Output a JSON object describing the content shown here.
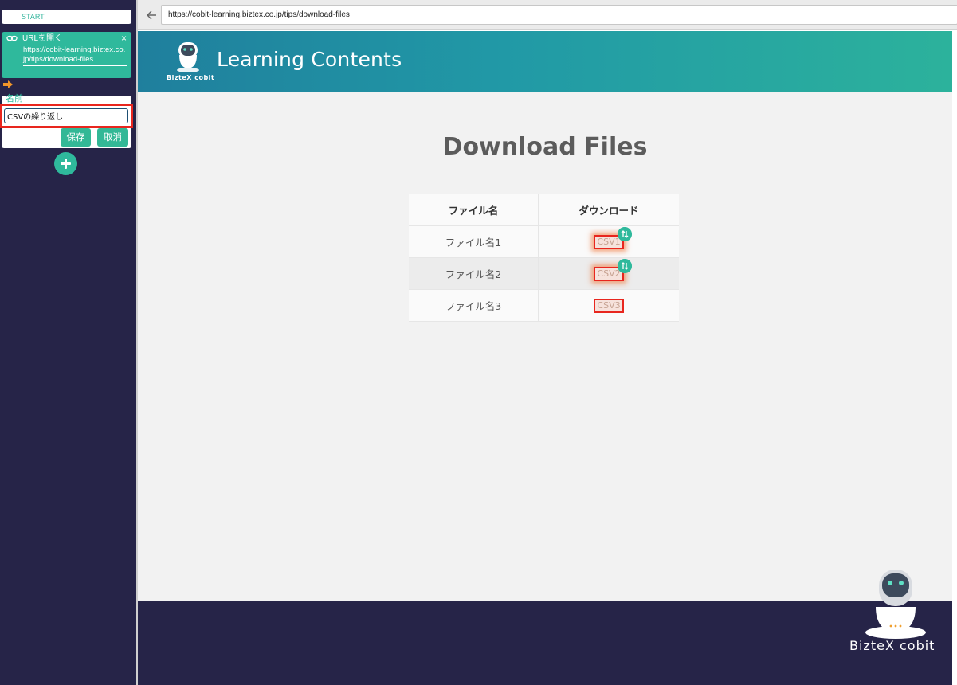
{
  "sidebar": {
    "start_label": "START",
    "url_block": {
      "title": "URLを開く",
      "close": "×",
      "url": "https://cobit-learning.biztex.co.jp/tips/download-files"
    },
    "name_label": "名前",
    "name_input_value": "CSVの繰り返し",
    "save_label": "保存",
    "cancel_label": "取消"
  },
  "browser": {
    "url": "https://cobit-learning.biztex.co.jp/tips/download-files"
  },
  "page": {
    "brand_small": "BizteX cobit",
    "header_title": "Learning Contents",
    "title": "Download Files",
    "table": {
      "headers": [
        "ファイル名",
        "ダウンロード"
      ],
      "rows": [
        {
          "name": "ファイル名1",
          "link": "CSV1"
        },
        {
          "name": "ファイル名2",
          "link": "CSV2"
        },
        {
          "name": "ファイル名3",
          "link": "CSV3"
        }
      ]
    },
    "footer_brand": "BizteX cobit"
  },
  "colors": {
    "accent": "#2fb99c",
    "sidebar_bg": "#262448",
    "highlight": "#e8261e"
  }
}
